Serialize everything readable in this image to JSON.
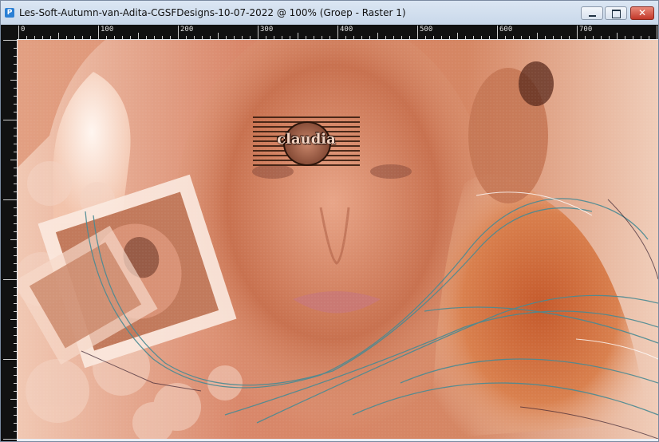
{
  "window": {
    "title": "Les-Soft-Autumn-van-Adita-CGSFDesigns-10-07-2022 @ 100% (Groep - Raster 1)",
    "app_icon_glyph": "P",
    "controls": {
      "minimize": "minimize-icon",
      "maximize": "maximize-icon",
      "close_glyph": "✕"
    }
  },
  "ruler": {
    "labels": [
      "0",
      "100",
      "200",
      "300",
      "400",
      "500",
      "600",
      "700"
    ]
  },
  "canvas": {
    "watermark_text": "claudia",
    "colors": {
      "base": "#e2a07f",
      "light": "#f6dccd",
      "dark": "#b4563a",
      "accent_lines": "#4a8a93"
    }
  }
}
